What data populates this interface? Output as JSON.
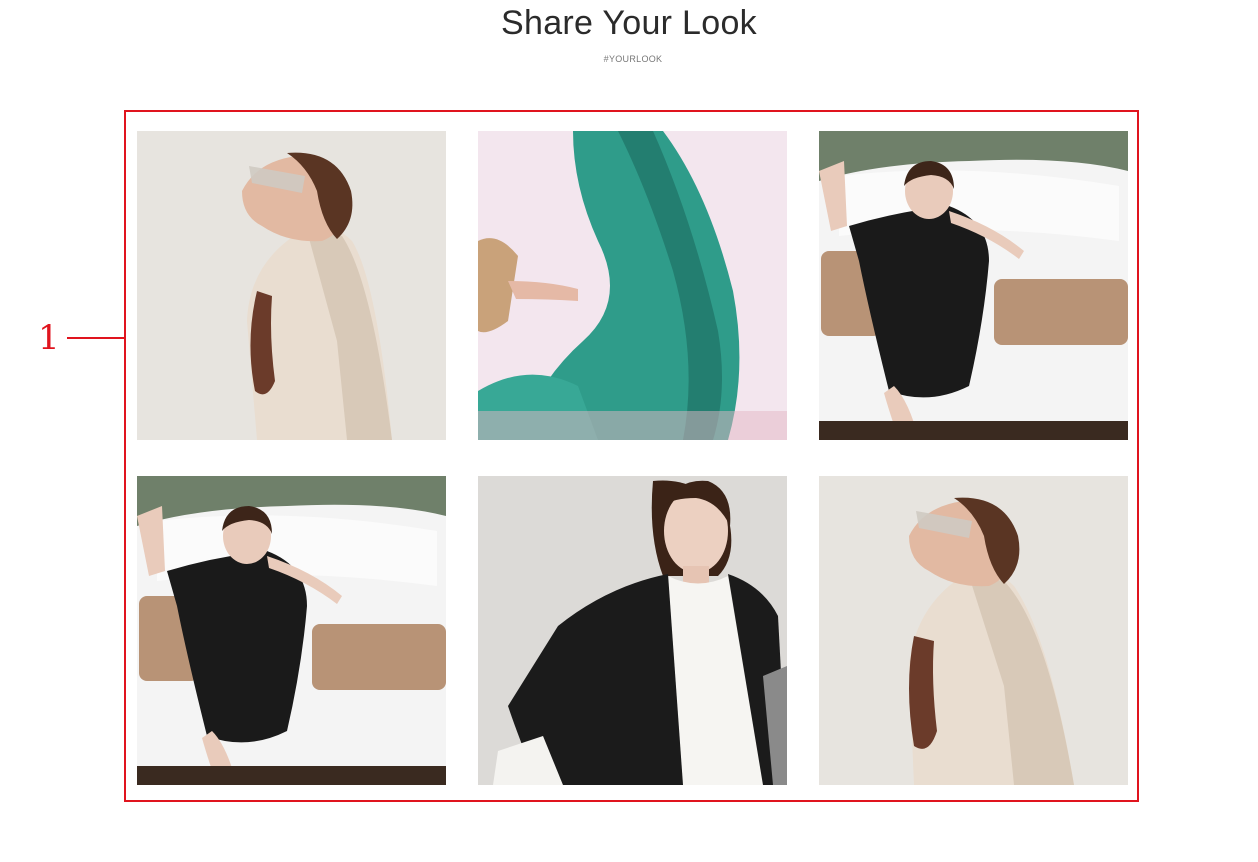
{
  "header": {
    "title": "Share Your Look",
    "subtitle": "#YOURLOOK"
  },
  "annotation": {
    "label": "1",
    "color": "#e0141e"
  },
  "gallery": {
    "items": [
      {
        "scene": "woman-cream-coat-sunglasses"
      },
      {
        "scene": "teal-fabric-flowing"
      },
      {
        "scene": "woman-black-dress-on-bed"
      },
      {
        "scene": "woman-black-dress-on-bed"
      },
      {
        "scene": "woman-black-cardigan-white-top"
      },
      {
        "scene": "woman-cream-coat-sunglasses"
      }
    ]
  },
  "colors": {
    "annotation_red": "#e0141e",
    "teal": "#2f9c8a",
    "cream": "#e9ddd0",
    "bed_white": "#f4f4f4",
    "headboard_green": "#6f806a"
  }
}
